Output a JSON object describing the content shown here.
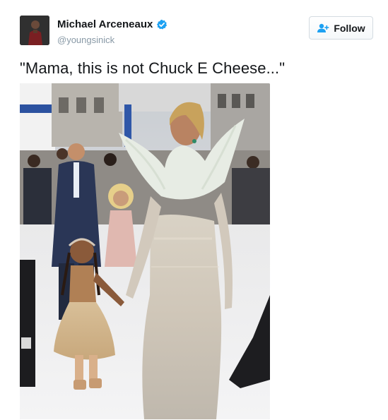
{
  "user": {
    "name": "Michael Arceneaux",
    "handle": "@youngsinick",
    "verified": true
  },
  "follow_button": {
    "label": "Follow",
    "icon": "add-user-icon"
  },
  "tweet": {
    "text": "\"Mama, this is not Chuck E Cheese...\""
  },
  "icons": {
    "verified": "verified-badge-icon",
    "follow": "add-user-icon"
  },
  "colors": {
    "text": "#14171a",
    "muted": "#8899a6",
    "verified": "#1da1f2",
    "follow_icon": "#1da1f2"
  }
}
